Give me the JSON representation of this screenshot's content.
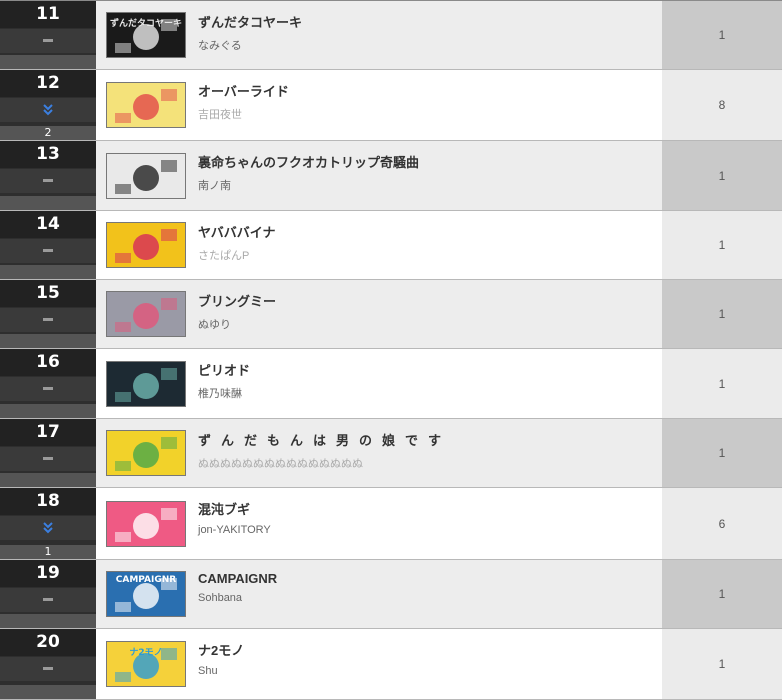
{
  "rows": [
    {
      "rank": "11",
      "change": "none",
      "change_value": "",
      "title": "ずんだタコヤーキ",
      "artist": "なみぐる",
      "count": "1",
      "thumb_label": "ずんだタコヤーキ",
      "thumb_bg": "#1a1a1a",
      "thumb_fg": "#e8e8e8"
    },
    {
      "rank": "12",
      "change": "down",
      "change_value": "2",
      "title": "オーバーライド",
      "artist": "吉田夜世",
      "count": "8",
      "thumb_label": "",
      "thumb_bg": "#f4e27a",
      "thumb_fg": "#e24a4a"
    },
    {
      "rank": "13",
      "change": "none",
      "change_value": "",
      "title": "裏命ちゃんのフクオカトリップ奇騒曲",
      "artist": "南ノ南",
      "count": "1",
      "thumb_label": "",
      "thumb_bg": "#e9e9e9",
      "thumb_fg": "#222222"
    },
    {
      "rank": "14",
      "change": "none",
      "change_value": "",
      "title": "ヤバババイナ",
      "artist": "さたぱんP",
      "count": "1",
      "thumb_label": "",
      "thumb_bg": "#f2c21b",
      "thumb_fg": "#d62a5a"
    },
    {
      "rank": "15",
      "change": "none",
      "change_value": "",
      "title": "ブリングミー",
      "artist": "ぬゆり",
      "count": "1",
      "thumb_label": "",
      "thumb_bg": "#9a9aa6",
      "thumb_fg": "#e2557a"
    },
    {
      "rank": "16",
      "change": "none",
      "change_value": "",
      "title": "ピリオド",
      "artist": "椎乃味醂",
      "count": "1",
      "thumb_label": "",
      "thumb_bg": "#1d2a33",
      "thumb_fg": "#6fb7b0"
    },
    {
      "rank": "17",
      "change": "none",
      "change_value": "",
      "title": "ずんだもんは男の娘です",
      "artist": "ぬぬぬぬぬぬぬぬぬぬぬぬぬぬぬ",
      "count": "1",
      "thumb_label": "",
      "thumb_bg": "#f2d22a",
      "thumb_fg": "#4aa84a"
    },
    {
      "rank": "18",
      "change": "down",
      "change_value": "1",
      "title": "混沌ブギ",
      "artist": "jon-YAKITORY",
      "count": "6",
      "thumb_label": "",
      "thumb_bg": "#ef5a84",
      "thumb_fg": "#ffffff"
    },
    {
      "rank": "19",
      "change": "none",
      "change_value": "",
      "title": "CAMPAIGNR",
      "artist": "Sohbana",
      "count": "1",
      "thumb_label": "CAMPAIGNR",
      "thumb_bg": "#2a6fb0",
      "thumb_fg": "#ffffff"
    },
    {
      "rank": "20",
      "change": "none",
      "change_value": "",
      "title": "ナ2モノ",
      "artist": "Shu",
      "count": "1",
      "thumb_label": "ナ2モノ",
      "thumb_bg": "#f5d13a",
      "thumb_fg": "#2a9bd8"
    }
  ],
  "colors": {
    "down_arrow": "#3b7fe0",
    "rank_bg": "#222222"
  }
}
